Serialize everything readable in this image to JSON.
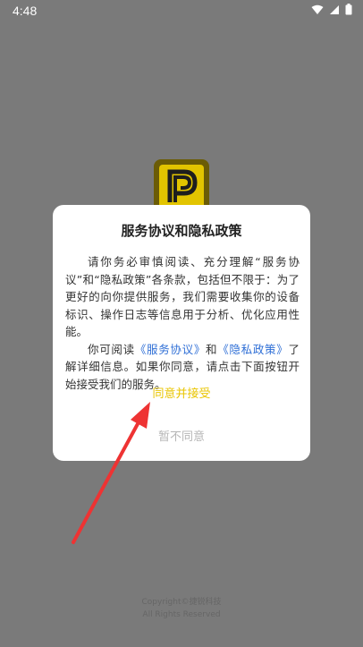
{
  "status_bar": {
    "time": "4:48",
    "icons": [
      "wifi-icon",
      "signal-icon",
      "battery-icon"
    ]
  },
  "colors": {
    "scrim_background": "#7a7a7a",
    "dialog_background": "#ffffff",
    "agree_color": "#e9c500",
    "disagree_color": "#b6b6b6",
    "link_color": "#2f6fd6",
    "arrow_color": "#ee3333"
  },
  "dialog": {
    "title": "服务协议和隐私政策",
    "paragraph1": "请你务必审慎阅读、充分理解“服务协议”和“隐私政策”各条款，包括但不限于：为了更好的向你提供服务，我们需要收集你的设备标识、操作日志等信息用于分析、优化应用性能。",
    "p2_prefix": "你可阅读",
    "link_service": "《服务协议》",
    "p2_and": "和",
    "link_privacy": "《隐私政策》",
    "p2_suffix": "了解详细信息。如果你同意，请点击下面按钮开始接受我们的服务。",
    "agree_label": "同意并接受",
    "disagree_label": "暂不同意"
  },
  "footer": {
    "line1": "Copyright©捷锐科技",
    "line2": "All Rights Reserved"
  }
}
